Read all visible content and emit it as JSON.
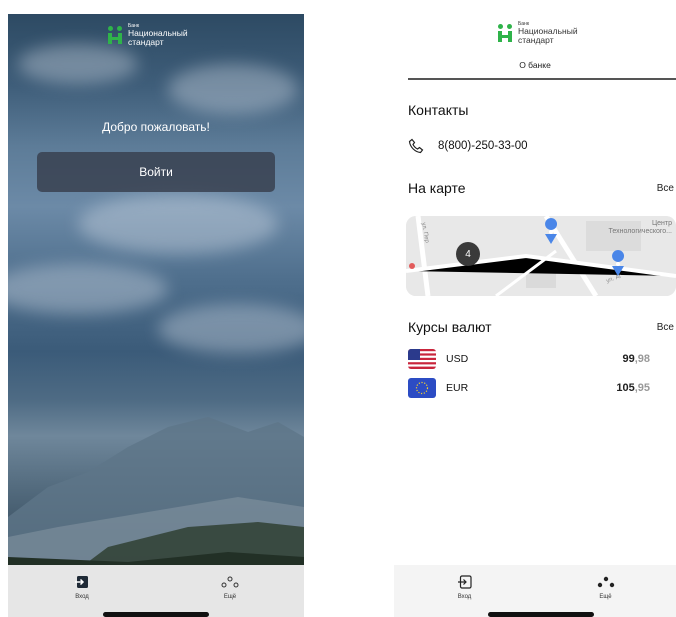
{
  "left_screen": {
    "logo": {
      "small": "Банк",
      "line1": "Национальный",
      "line2": "стандарт"
    },
    "welcome_text": "Добро пожаловать!",
    "login_button": "Войти",
    "tabbar": [
      {
        "label": "Вход",
        "icon": "login-icon"
      },
      {
        "label": "Ещё",
        "icon": "more-dots-icon"
      }
    ]
  },
  "right_screen": {
    "logo": {
      "small": "Банк",
      "line1": "Национальный",
      "line2": "стандарт"
    },
    "header_link": "О банке",
    "contacts": {
      "title": "Контакты",
      "phone": "8(800)-250-33-00",
      "icon": "phone-icon"
    },
    "map_section": {
      "title": "На карте",
      "all_link": "Все",
      "cluster_count": "4",
      "street_labels": [
        "ул. Пер",
        "ул. Аг",
        "Центр",
        "Технологического..."
      ]
    },
    "rates": {
      "title": "Курсы валют",
      "all_link": "Все",
      "items": [
        {
          "code": "USD",
          "main": "99",
          "frac": ",98",
          "flag": "us-flag-icon"
        },
        {
          "code": "EUR",
          "main": "105",
          "frac": ",95",
          "flag": "eu-flag-icon"
        }
      ]
    },
    "tabbar": [
      {
        "label": "Вход",
        "icon": "login-icon"
      },
      {
        "label": "Ещё",
        "icon": "more-dots-icon"
      }
    ]
  },
  "colors": {
    "brand_green": "#2fb34a",
    "map_pin": "#4a86e8",
    "cluster": "#3a3a3a"
  }
}
